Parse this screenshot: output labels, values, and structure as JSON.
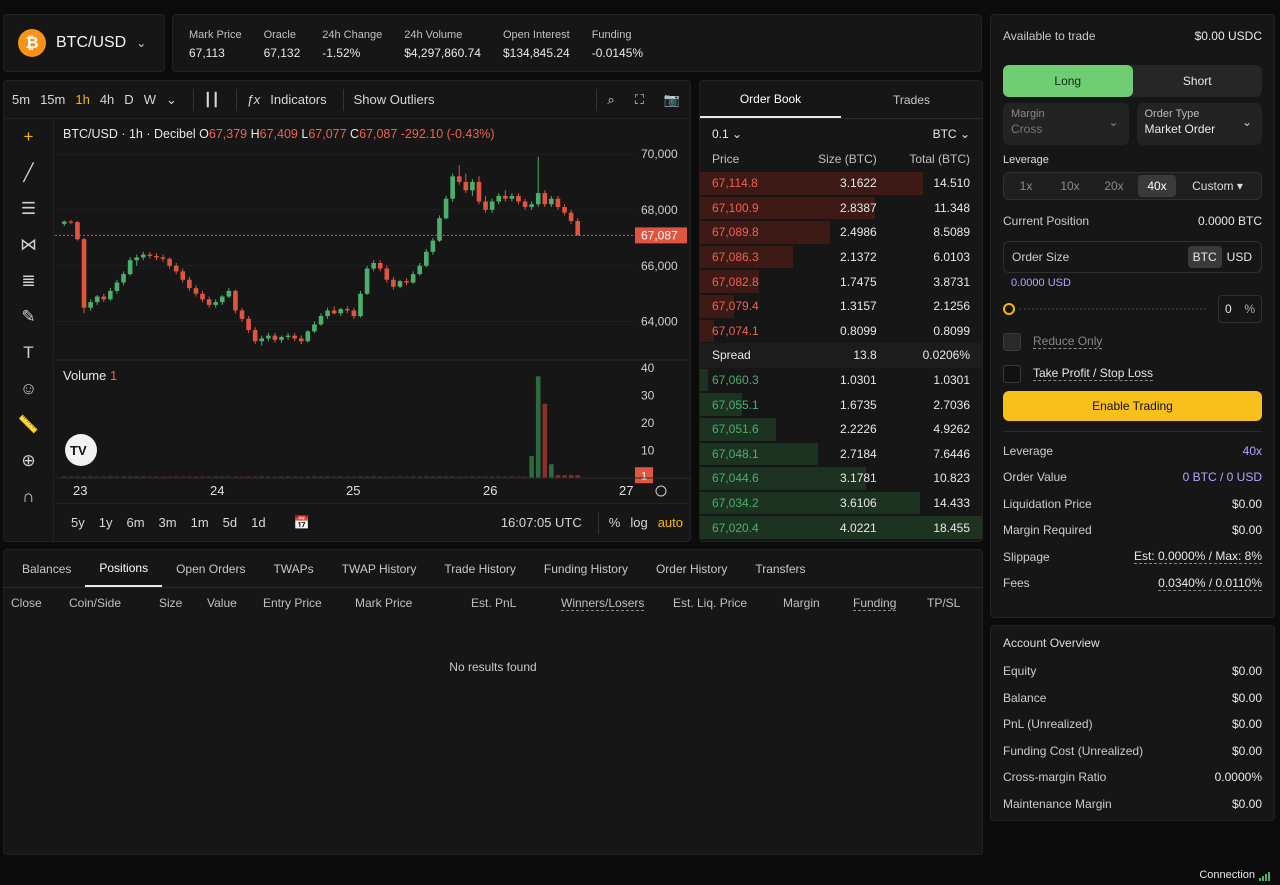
{
  "pair": {
    "name": "BTC/USD",
    "logo": "₿"
  },
  "stats": [
    {
      "label": "Mark Price",
      "value": "67,113",
      "color": "normal"
    },
    {
      "label": "Oracle",
      "value": "67,132",
      "color": "normal"
    },
    {
      "label": "24h Change",
      "value": "-1.52%",
      "color": "red"
    },
    {
      "label": "24h Volume",
      "value": "$4,297,860.74",
      "color": "normal"
    },
    {
      "label": "Open Interest",
      "value": "$134,845.24",
      "color": "normal"
    },
    {
      "label": "Funding",
      "value": "-0.0145%",
      "color": "red"
    }
  ],
  "toolbar": {
    "timeframes": [
      "5m",
      "15m",
      "1h",
      "4h",
      "D",
      "W"
    ],
    "active_tf": "1h",
    "indicators": "Indicators",
    "outliers": "Show Outliers"
  },
  "chart_header": {
    "symbol": "BTC/USD · 1h · Decibel",
    "o_label": "O",
    "o": "67,379",
    "h_label": "H",
    "h": "67,409",
    "l_label": "L",
    "l": "67,077",
    "c_label": "C",
    "c": "67,087",
    "change": "-292.10 (-0.43%)"
  },
  "volume_label": {
    "text": "Volume",
    "value": "1"
  },
  "range_bar": {
    "ranges": [
      "5y",
      "1y",
      "6m",
      "3m",
      "1m",
      "5d",
      "1d"
    ],
    "time": "16:07:05 UTC",
    "pct": "%",
    "log": "log",
    "auto": "auto"
  },
  "chart_data": {
    "type": "candlestick",
    "x_ticks": [
      "23",
      "24",
      "25",
      "26",
      "27"
    ],
    "y_ticks": [
      "70,000",
      "68,000",
      "66,000",
      "64,000"
    ],
    "ylim": [
      62700,
      70500
    ],
    "last_price": "67,087",
    "volume_ticks": [
      "40",
      "30",
      "20",
      "10"
    ],
    "volume_last": "1",
    "candles": [
      [
        67500,
        67620,
        67420,
        67580
      ],
      [
        67580,
        67640,
        67500,
        67560
      ],
      [
        67560,
        67600,
        66900,
        66950
      ],
      [
        66950,
        67000,
        64300,
        64500
      ],
      [
        64500,
        64800,
        64400,
        64700
      ],
      [
        64700,
        64950,
        64600,
        64900
      ],
      [
        64900,
        65000,
        64700,
        64800
      ],
      [
        64800,
        65200,
        64750,
        65100
      ],
      [
        65100,
        65500,
        65000,
        65400
      ],
      [
        65400,
        65800,
        65300,
        65700
      ],
      [
        65700,
        66300,
        65650,
        66200
      ],
      [
        66200,
        66400,
        66000,
        66300
      ],
      [
        66300,
        66500,
        66200,
        66400
      ],
      [
        66400,
        66500,
        66250,
        66350
      ],
      [
        66350,
        66450,
        66200,
        66300
      ],
      [
        66300,
        66400,
        66150,
        66250
      ],
      [
        66250,
        66300,
        65900,
        66000
      ],
      [
        66000,
        66100,
        65700,
        65800
      ],
      [
        65800,
        65900,
        65400,
        65500
      ],
      [
        65500,
        65600,
        65100,
        65200
      ],
      [
        65200,
        65300,
        64900,
        65000
      ],
      [
        65000,
        65100,
        64700,
        64800
      ],
      [
        64800,
        64900,
        64500,
        64600
      ],
      [
        64600,
        64800,
        64500,
        64700
      ],
      [
        64700,
        64950,
        64600,
        64900
      ],
      [
        64900,
        65200,
        64850,
        65100
      ],
      [
        65100,
        65150,
        64300,
        64400
      ],
      [
        64400,
        64500,
        64000,
        64100
      ],
      [
        64100,
        64200,
        63600,
        63700
      ],
      [
        63700,
        63800,
        63200,
        63300
      ],
      [
        63300,
        63500,
        63150,
        63400
      ],
      [
        63400,
        63600,
        63300,
        63500
      ],
      [
        63500,
        63600,
        63250,
        63350
      ],
      [
        63350,
        63500,
        63250,
        63450
      ],
      [
        63450,
        63600,
        63350,
        63500
      ],
      [
        63500,
        63600,
        63300,
        63400
      ],
      [
        63400,
        63500,
        63200,
        63300
      ],
      [
        63300,
        63700,
        63250,
        63650
      ],
      [
        63650,
        64000,
        63600,
        63900
      ],
      [
        63900,
        64300,
        63850,
        64200
      ],
      [
        64200,
        64500,
        64100,
        64400
      ],
      [
        64400,
        64550,
        64250,
        64300
      ],
      [
        64300,
        64500,
        64200,
        64450
      ],
      [
        64450,
        64550,
        64300,
        64400
      ],
      [
        64400,
        64500,
        64100,
        64200
      ],
      [
        64200,
        65100,
        64150,
        65000
      ],
      [
        65000,
        66000,
        64950,
        65900
      ],
      [
        65900,
        66200,
        65800,
        66100
      ],
      [
        66100,
        66200,
        65800,
        65900
      ],
      [
        65900,
        66000,
        65400,
        65500
      ],
      [
        65500,
        65600,
        65150,
        65250
      ],
      [
        65250,
        65500,
        65200,
        65450
      ],
      [
        65450,
        65550,
        65300,
        65400
      ],
      [
        65400,
        65800,
        65350,
        65700
      ],
      [
        65700,
        66100,
        65650,
        66000
      ],
      [
        66000,
        66600,
        65950,
        66500
      ],
      [
        66500,
        67000,
        66400,
        66900
      ],
      [
        66900,
        67800,
        66850,
        67700
      ],
      [
        67700,
        68500,
        67650,
        68400
      ],
      [
        68400,
        69300,
        68300,
        69200
      ],
      [
        69200,
        69600,
        68900,
        69000
      ],
      [
        69000,
        69300,
        68600,
        68700
      ],
      [
        68700,
        69100,
        68500,
        69000
      ],
      [
        69000,
        69200,
        68200,
        68300
      ],
      [
        68300,
        68500,
        67900,
        68000
      ],
      [
        68000,
        68400,
        67900,
        68300
      ],
      [
        68300,
        68600,
        68200,
        68500
      ],
      [
        68500,
        68700,
        68300,
        68400
      ],
      [
        68400,
        68600,
        68300,
        68500
      ],
      [
        68500,
        68600,
        68200,
        68300
      ],
      [
        68300,
        68400,
        68000,
        68100
      ],
      [
        68100,
        68300,
        68000,
        68200
      ],
      [
        68200,
        69900,
        68100,
        68600
      ],
      [
        68600,
        68700,
        68100,
        68200
      ],
      [
        68200,
        68500,
        68100,
        68400
      ],
      [
        68400,
        68500,
        68000,
        68100
      ],
      [
        68100,
        68200,
        67800,
        67900
      ],
      [
        67900,
        68000,
        67500,
        67600
      ],
      [
        67600,
        67700,
        67087,
        67087
      ]
    ],
    "volumes": [
      0,
      0,
      0,
      0,
      0,
      0,
      0,
      0,
      0,
      0,
      0,
      0,
      0,
      0,
      0,
      0,
      0,
      0,
      0,
      0,
      0,
      0,
      0,
      0,
      0,
      0,
      0,
      0,
      0,
      0,
      0,
      0,
      0,
      0,
      0,
      0,
      0,
      0,
      0,
      0,
      0,
      0,
      0,
      0,
      0,
      0,
      0,
      0,
      0,
      0,
      0,
      0,
      0,
      0,
      0,
      0,
      0,
      0,
      0,
      0,
      0,
      0,
      0,
      0,
      0,
      0,
      0,
      0,
      0,
      0,
      0,
      8,
      37,
      27,
      5,
      1,
      1,
      1,
      1
    ]
  },
  "book": {
    "tabs": [
      "Order Book",
      "Trades"
    ],
    "tick": "0.1",
    "unit": "BTC",
    "headers": [
      "Price",
      "Size (BTC)",
      "Total (BTC)"
    ],
    "asks": [
      {
        "price": "67,114.8",
        "size": "3.1622",
        "total": "14.510",
        "depth": 0.79
      },
      {
        "price": "67,100.9",
        "size": "2.8387",
        "total": "11.348",
        "depth": 0.62
      },
      {
        "price": "67,089.8",
        "size": "2.4986",
        "total": "8.5089",
        "depth": 0.46
      },
      {
        "price": "67,086.3",
        "size": "2.1372",
        "total": "6.0103",
        "depth": 0.33
      },
      {
        "price": "67,082.8",
        "size": "1.7475",
        "total": "3.8731",
        "depth": 0.21
      },
      {
        "price": "67,079.4",
        "size": "1.3157",
        "total": "2.1256",
        "depth": 0.12
      },
      {
        "price": "67,074.1",
        "size": "0.8099",
        "total": "0.8099",
        "depth": 0.05
      }
    ],
    "spread": {
      "label": "Spread",
      "value": "13.8",
      "pct": "0.0206%"
    },
    "bids": [
      {
        "price": "67,060.3",
        "size": "1.0301",
        "total": "1.0301",
        "depth": 0.03
      },
      {
        "price": "67,055.1",
        "size": "1.6735",
        "total": "2.7036",
        "depth": 0.15
      },
      {
        "price": "67,051.6",
        "size": "2.2226",
        "total": "4.9262",
        "depth": 0.27
      },
      {
        "price": "67,048.1",
        "size": "2.7184",
        "total": "7.6446",
        "depth": 0.42
      },
      {
        "price": "67,044.6",
        "size": "3.1781",
        "total": "10.823",
        "depth": 0.59
      },
      {
        "price": "67,034.2",
        "size": "3.6106",
        "total": "14.433",
        "depth": 0.78
      },
      {
        "price": "67,020.4",
        "size": "4.0221",
        "total": "18.455",
        "depth": 1.0
      }
    ]
  },
  "positions": {
    "tabs": [
      "Balances",
      "Positions",
      "Open Orders",
      "TWAPs",
      "TWAP History",
      "Trade History",
      "Funding History",
      "Order History",
      "Transfers"
    ],
    "active": "Positions",
    "columns": [
      "Close",
      "Coin/Side",
      "Size",
      "Value",
      "Entry Price",
      "Mark Price",
      "Est. PnL",
      "Winners/Losers",
      "Est. Liq. Price",
      "Margin",
      "Funding",
      "TP/SL"
    ],
    "empty": "No results found"
  },
  "trade": {
    "available_label": "Available to trade",
    "available": "$0.00 USDC",
    "long": "Long",
    "short": "Short",
    "margin_label": "Margin",
    "margin_value": "Cross",
    "order_type_label": "Order Type",
    "order_type_value": "Market Order",
    "leverage_label": "Leverage",
    "leverage_options": [
      "1x",
      "10x",
      "20x",
      "40x"
    ],
    "leverage_active": "40x",
    "custom": "Custom",
    "current_position_label": "Current Position",
    "current_position": "0.0000 BTC",
    "order_size_label": "Order Size",
    "unit_btc": "BTC",
    "unit_usd": "USD",
    "order_size_usd": "0.0000 USD",
    "slider_pct": "0",
    "pct_sign": "%",
    "reduce_only": "Reduce Only",
    "tpsl": "Take Profit / Stop Loss",
    "enable": "Enable Trading",
    "summary": [
      {
        "label": "Leverage",
        "value": "40x",
        "accent": true,
        "dotted": false
      },
      {
        "label": "Order Value",
        "value": "0 BTC / 0 USD",
        "accent": true,
        "dotted": false
      },
      {
        "label": "Liquidation Price",
        "value": "$0.00",
        "accent": false,
        "dotted": false
      },
      {
        "label": "Margin Required",
        "value": "$0.00",
        "accent": false,
        "dotted": false
      },
      {
        "label": "Slippage",
        "value": "Est: 0.0000% / Max: 8%",
        "accent": false,
        "dotted": true
      },
      {
        "label": "Fees",
        "value": "0.0340% / 0.0110%",
        "accent": false,
        "dotted": true
      }
    ]
  },
  "account": {
    "title": "Account Overview",
    "rows": [
      {
        "label": "Equity",
        "value": "$0.00"
      },
      {
        "label": "Balance",
        "value": "$0.00"
      },
      {
        "label": "PnL (Unrealized)",
        "value": "$0.00"
      },
      {
        "label": "Funding Cost (Unrealized)",
        "value": "$0.00"
      },
      {
        "label": "Cross-margin Ratio",
        "value": "0.0000%"
      },
      {
        "label": "Maintenance Margin",
        "value": "$0.00"
      }
    ]
  },
  "connection": "Connection",
  "colors": {
    "up": "#4caf6a",
    "down": "#e0553f",
    "accent": "#f5b800",
    "purple": "#b9a3ff"
  }
}
